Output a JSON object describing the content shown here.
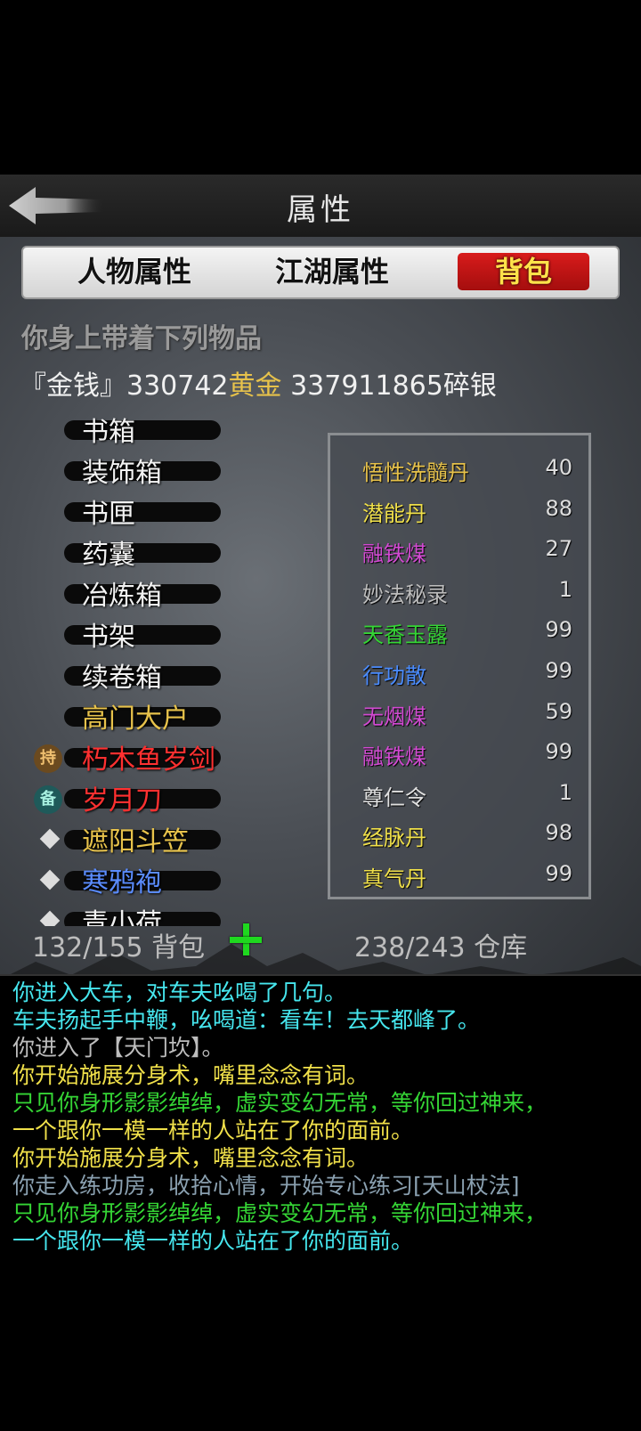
{
  "header": {
    "title": "属性"
  },
  "tabs": [
    {
      "label": "人物属性"
    },
    {
      "label": "江湖属性"
    },
    {
      "label": "背包",
      "active": true
    }
  ],
  "inventory": {
    "subtitle": "你身上带着下列物品",
    "money": {
      "prefix": "『金钱』",
      "gold_amount": "330742",
      "gold_label": "黄金",
      "silver_amount": " 337911865",
      "silver_label": "碎银"
    },
    "containers": [
      {
        "label": "书箱",
        "color": "#f2f2f2"
      },
      {
        "label": "装饰箱",
        "color": "#f2f2f2"
      },
      {
        "label": "书匣",
        "color": "#f2f2f2"
      },
      {
        "label": "药囊",
        "color": "#f2f2f2"
      },
      {
        "label": "冶炼箱",
        "color": "#f2f2f2"
      },
      {
        "label": "书架",
        "color": "#f2f2f2"
      },
      {
        "label": "续卷箱",
        "color": "#f2f2f2"
      },
      {
        "label": "高门大户",
        "color": "#e7c24b"
      },
      {
        "label": "朽木鱼岁剑",
        "color": "#ff3030",
        "badge": "持"
      },
      {
        "label": "岁月刀",
        "color": "#ff3030",
        "badge": "备"
      },
      {
        "label": "遮阳斗笠",
        "color": "#e7c24b",
        "marker": "diamond"
      },
      {
        "label": "寒鸦袍",
        "color": "#5a8cff",
        "marker": "diamond"
      },
      {
        "label": "青小荷",
        "color": "#f2f2f2",
        "marker": "diamond"
      }
    ],
    "quick_items": [
      {
        "name": "悟性洗髓丹",
        "count": "40",
        "color": "#e7c24b"
      },
      {
        "name": "潜能丹",
        "count": "88",
        "color": "#f0e04a"
      },
      {
        "name": "融铁煤",
        "count": "27",
        "color": "#d24ad2"
      },
      {
        "name": "妙法秘录",
        "count": "1",
        "color": "#bdbdbd"
      },
      {
        "name": "天香玉露",
        "count": "99",
        "color": "#35d535"
      },
      {
        "name": "行功散",
        "count": "99",
        "color": "#4a8cff"
      },
      {
        "name": "无烟煤",
        "count": "59",
        "color": "#d24ad2"
      },
      {
        "name": "融铁煤",
        "count": "99",
        "color": "#d24ad2"
      },
      {
        "name": "尊仁令",
        "count": "1",
        "color": "#e0e0e0"
      },
      {
        "name": "经脉丹",
        "count": "98",
        "color": "#f0e04a"
      },
      {
        "name": "真气丹",
        "count": "99",
        "color": "#f0e04a"
      }
    ],
    "bag_capacity": "132/155 背包",
    "store_capacity": "238/243 仓库"
  },
  "log": [
    {
      "text": "你进入大车，对车夫吆喝了几句。",
      "color": "#46e6ee"
    },
    {
      "text": "车夫扬起手中鞭，吆喝道：看车！去天都峰了。",
      "color": "#46e6ee"
    },
    {
      "text": "你进入了【天门坎】。",
      "color": "#bdbdbd"
    },
    {
      "text": "你开始施展分身术，嘴里念念有词。",
      "color": "#f0e04a"
    },
    {
      "text": "只见你身形影影绰绰，虚实变幻无常，等你回过神来，",
      "color": "#35d535"
    },
    {
      "text": "一个跟你一模一样的人站在了你的面前。",
      "color": "#f0e04a"
    },
    {
      "text": "你开始施展分身术，嘴里念念有词。",
      "color": "#f0e04a"
    },
    {
      "text": "你走入练功房，收拾心情，开始专心练习[天山杖法]",
      "color": "#8aa0b0"
    },
    {
      "text": "只见你身形影影绰绰，虚实变幻无常，等你回过神来，",
      "color": "#35d535"
    },
    {
      "text": "一个跟你一模一样的人站在了你的面前。",
      "color": "#46e6ee"
    }
  ]
}
